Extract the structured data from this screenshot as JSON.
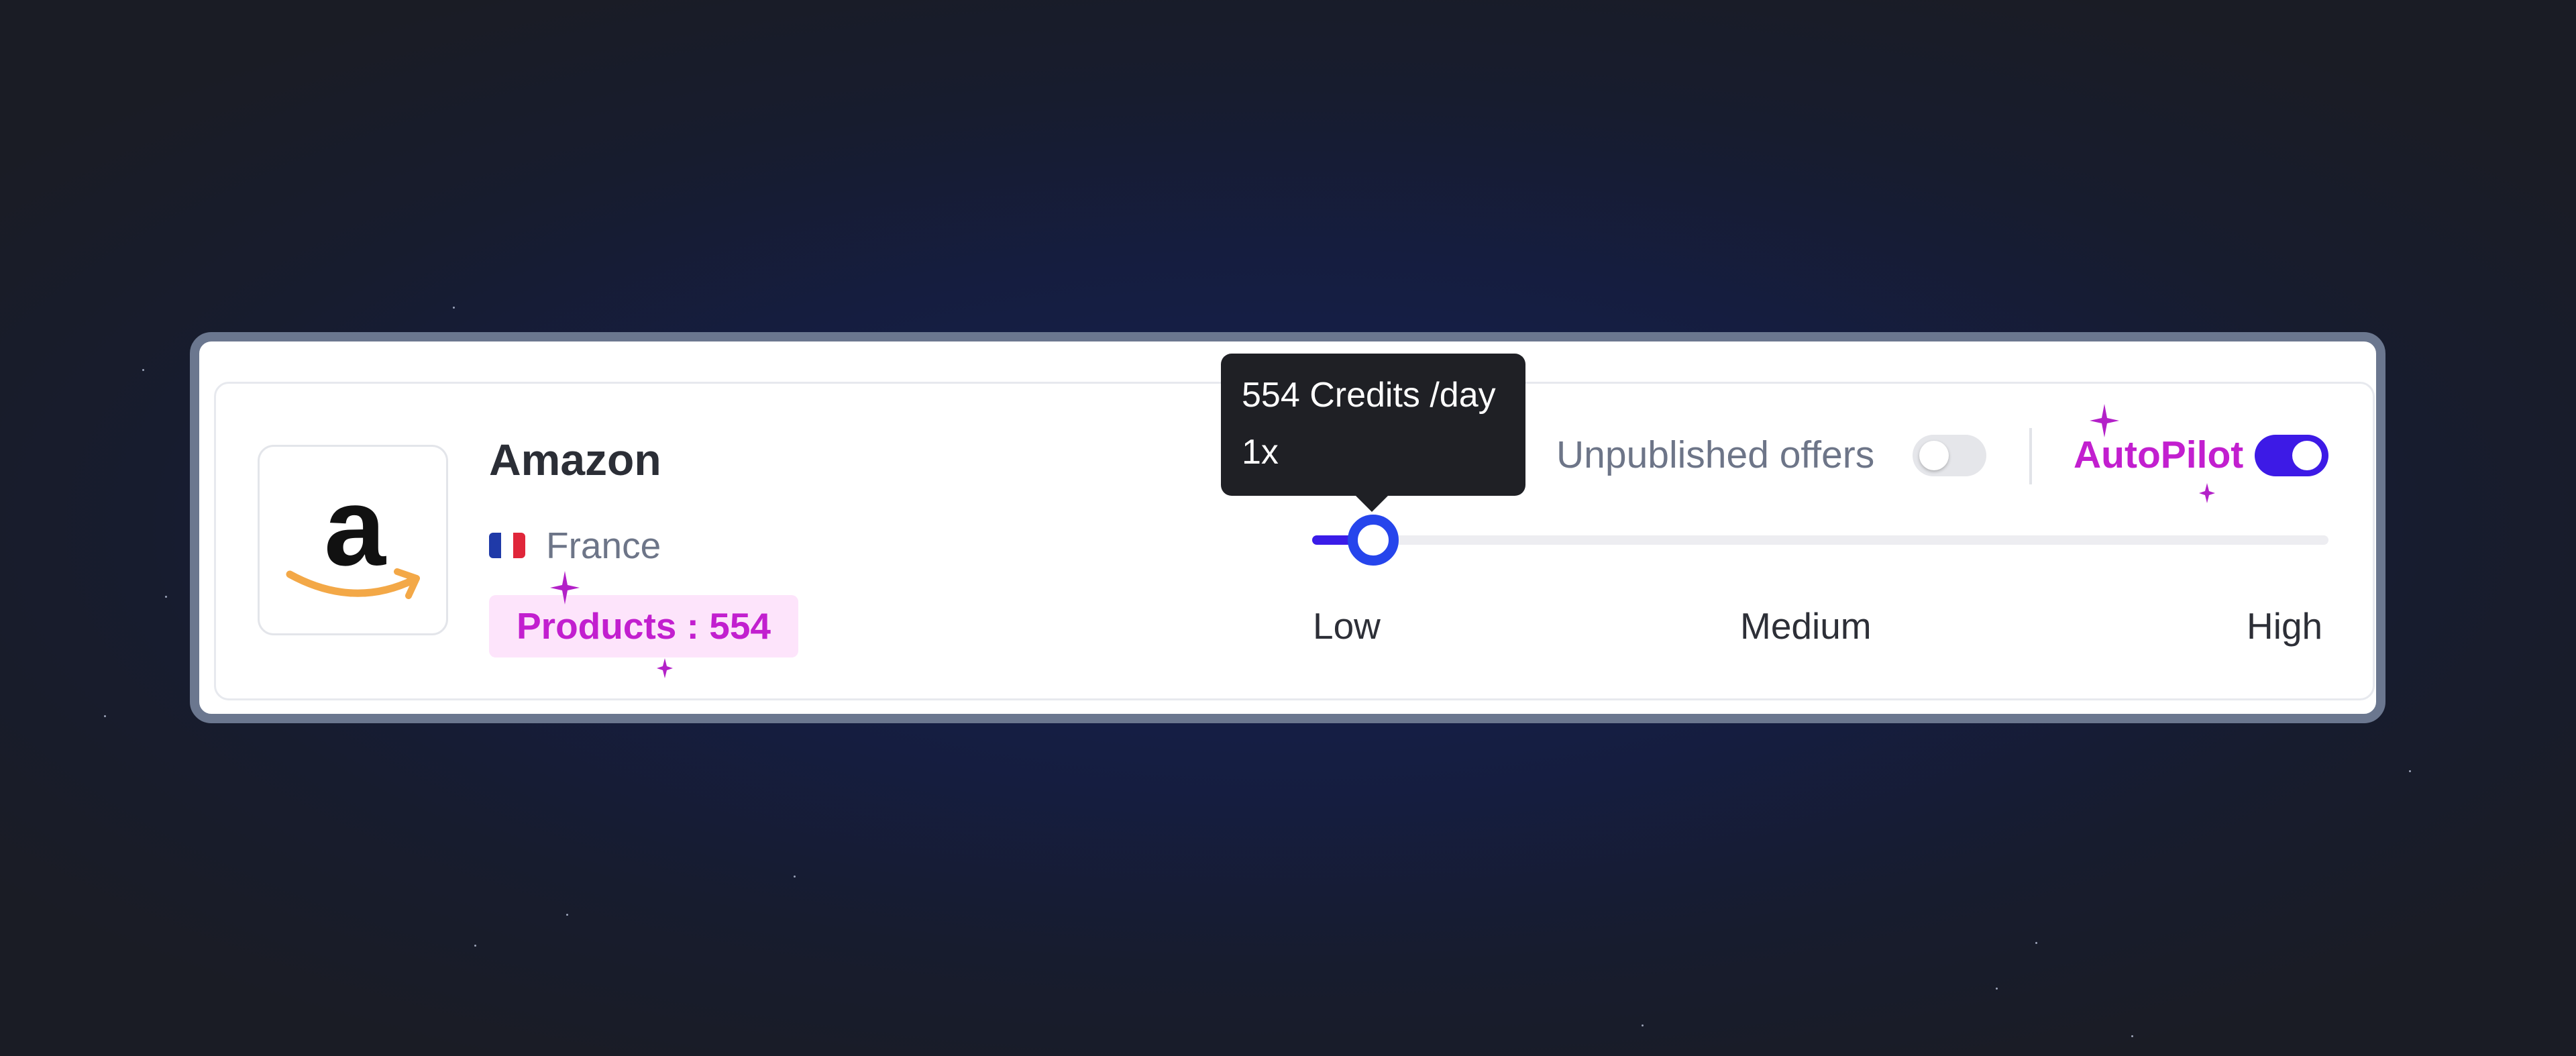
{
  "store": {
    "name": "Amazon",
    "country": "France",
    "products_label": "Products : 554",
    "logo_icon": "amazon-logo-icon"
  },
  "slider": {
    "tooltip": {
      "credits": "554 Credits /day",
      "multiplier": "1x"
    },
    "levels": [
      "Low",
      "Medium",
      "High"
    ],
    "value_fraction": 0.06,
    "accent_color": "#3a1ce8",
    "thumb_color": "#2645ec"
  },
  "controls": {
    "unpublished_offers_label": "Unpublished offers",
    "unpublished_offers_enabled": false,
    "autopilot_label": "AutoPilot",
    "autopilot_enabled": true
  },
  "colors": {
    "brand_magenta": "#c21fcf",
    "badge_bg": "#fde4fb",
    "toggle_on": "#3d1ae6",
    "amazon_orange": "#f3a847"
  }
}
